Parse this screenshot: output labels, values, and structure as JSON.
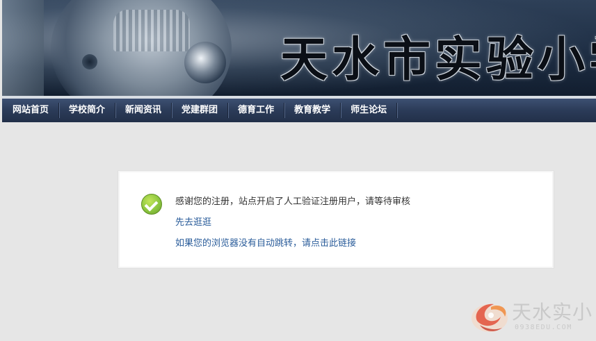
{
  "banner": {
    "title": "天水市实验小学"
  },
  "nav": {
    "items": [
      {
        "label": "网站首页"
      },
      {
        "label": "学校简介"
      },
      {
        "label": "新闻资讯"
      },
      {
        "label": "党建群团"
      },
      {
        "label": "德育工作"
      },
      {
        "label": "教育教学"
      },
      {
        "label": "师生论坛"
      }
    ]
  },
  "message": {
    "icon": "check-circle-icon",
    "text": "感谢您的注册，站点开启了人工验证注册用户，请等待审核",
    "link_browse": "先去逛逛",
    "link_redirect": "如果您的浏览器没有自动跳转，请点击此链接"
  },
  "watermark": {
    "title": "天水实小",
    "subtitle": "0938EDU.COM"
  },
  "colors": {
    "nav_bg": "#2b3b58",
    "link": "#2a5c9a",
    "success": "#8cc63f"
  }
}
